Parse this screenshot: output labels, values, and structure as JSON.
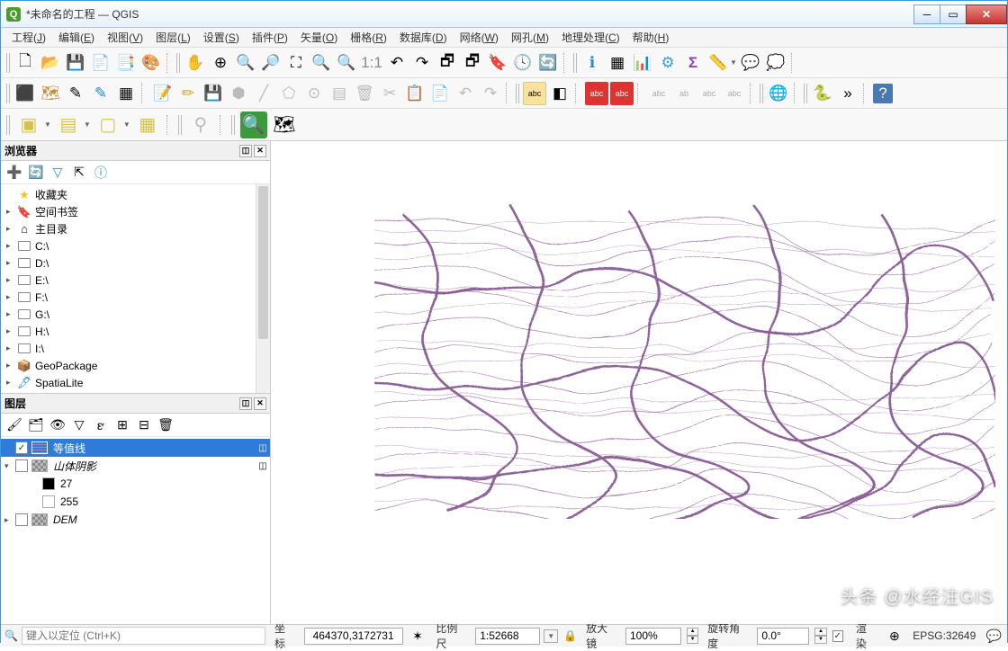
{
  "window": {
    "title": "*未命名的工程 — QGIS"
  },
  "menus": [
    {
      "label": "工程",
      "key": "J"
    },
    {
      "label": "编辑",
      "key": "E"
    },
    {
      "label": "视图",
      "key": "V"
    },
    {
      "label": "图层",
      "key": "L"
    },
    {
      "label": "设置",
      "key": "S"
    },
    {
      "label": "插件",
      "key": "P"
    },
    {
      "label": "矢量",
      "key": "O"
    },
    {
      "label": "栅格",
      "key": "R"
    },
    {
      "label": "数据库",
      "key": "D"
    },
    {
      "label": "网络",
      "key": "W"
    },
    {
      "label": "网孔",
      "key": "M"
    },
    {
      "label": "地理处理",
      "key": "C"
    },
    {
      "label": "帮助",
      "key": "H"
    }
  ],
  "browser": {
    "title": "浏览器",
    "items": [
      {
        "label": "收藏夹",
        "icon": "star"
      },
      {
        "label": "空间书签",
        "icon": "bookmark",
        "expandable": true
      },
      {
        "label": "主目录",
        "icon": "home",
        "expandable": true
      },
      {
        "label": "C:\\",
        "icon": "folder",
        "expandable": true
      },
      {
        "label": "D:\\",
        "icon": "folder",
        "expandable": true
      },
      {
        "label": "E:\\",
        "icon": "folder",
        "expandable": true
      },
      {
        "label": "F:\\",
        "icon": "folder",
        "expandable": true
      },
      {
        "label": "G:\\",
        "icon": "folder",
        "expandable": true
      },
      {
        "label": "H:\\",
        "icon": "folder",
        "expandable": true
      },
      {
        "label": "I:\\",
        "icon": "folder",
        "expandable": true
      },
      {
        "label": "GeoPackage",
        "icon": "gpkg",
        "expandable": true
      },
      {
        "label": "SpatiaLite",
        "icon": "slite",
        "expandable": true
      }
    ]
  },
  "layers": {
    "title": "图层",
    "items": [
      {
        "label": "等值线",
        "checked": true,
        "selected": true,
        "style": "contour",
        "italic": false
      },
      {
        "label": "山体阴影",
        "checked": false,
        "style": "hillshade",
        "italic": true,
        "expandable": true,
        "expanded": true,
        "children": [
          {
            "label": "27",
            "swatch": "#000"
          },
          {
            "label": "255",
            "swatch": "#fff"
          }
        ]
      },
      {
        "label": "DEM",
        "checked": false,
        "style": "dem",
        "italic": true
      }
    ]
  },
  "status": {
    "locator_placeholder": "键入以定位 (Ctrl+K)",
    "coord_label": "坐标",
    "coord_value": "464370,3172731",
    "scale_label": "比例尺",
    "scale_value": "1:52668",
    "magnifier_label": "放大镜",
    "magnifier_value": "100%",
    "rotation_label": "旋转角度",
    "rotation_value": "0.0°",
    "render_label": "渲染",
    "crs": "EPSG:32649"
  },
  "watermark": "头条 @水经注GIS"
}
